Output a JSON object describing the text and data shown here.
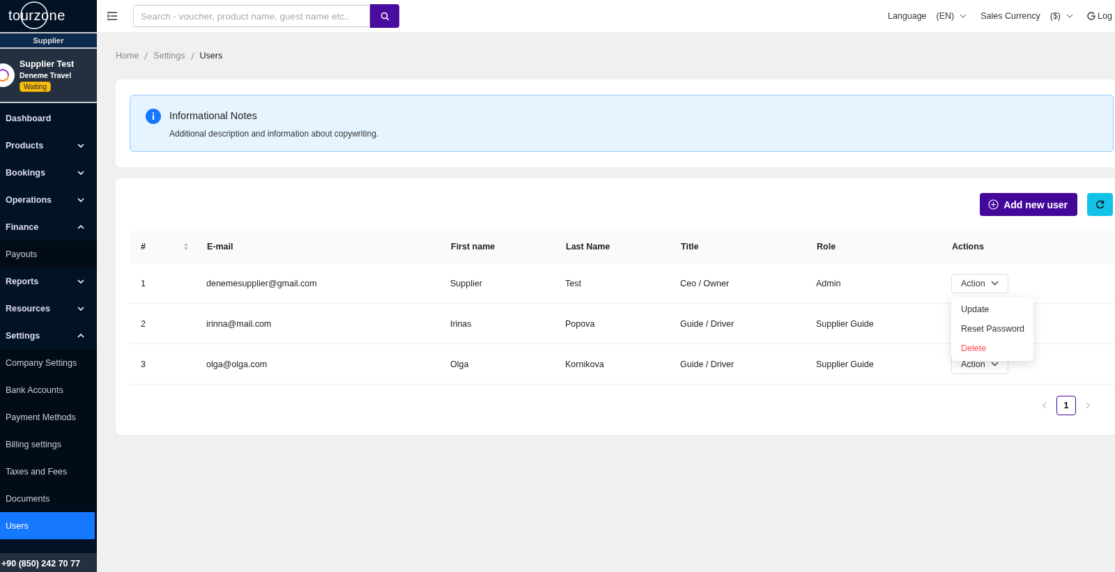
{
  "brand": {
    "logo": "tourzone",
    "role": "Supplier"
  },
  "profile": {
    "name": "Supplier Test",
    "company": "Deneme Travel",
    "status": "Waiting"
  },
  "sidebar": {
    "items": [
      {
        "label": "Dashboard",
        "kind": "item",
        "selected": false
      },
      {
        "label": "Products",
        "kind": "group",
        "expanded": false,
        "selected": false
      },
      {
        "label": "Bookings",
        "kind": "group",
        "expanded": false,
        "selected": false
      },
      {
        "label": "Operations",
        "kind": "group",
        "expanded": false,
        "selected": false
      },
      {
        "label": "Finance",
        "kind": "group",
        "expanded": true,
        "selected": false,
        "children": [
          {
            "label": "Payouts",
            "selected": false
          }
        ]
      },
      {
        "label": "Reports",
        "kind": "group",
        "expanded": false,
        "selected": false
      },
      {
        "label": "Resources",
        "kind": "group",
        "expanded": false,
        "selected": false
      },
      {
        "label": "Settings",
        "kind": "group",
        "expanded": true,
        "selected": false,
        "children": [
          {
            "label": "Company Settings",
            "selected": false
          },
          {
            "label": "Bank Accounts",
            "selected": false
          },
          {
            "label": "Payment Methods",
            "selected": false
          },
          {
            "label": "Billing settings",
            "selected": false
          },
          {
            "label": "Taxes and Fees",
            "selected": false
          },
          {
            "label": "Documents",
            "selected": false
          },
          {
            "label": "Users",
            "selected": true
          }
        ]
      }
    ]
  },
  "phone": "+90 (850) 242 70 77",
  "topbar": {
    "search": {
      "placeholder": "Search - voucher, product name, guest name etc.."
    },
    "language_label": "Language",
    "language": "(EN)",
    "currency_label": "Sales Currency",
    "currency": "($)",
    "logout": "Log"
  },
  "breadcrumb": [
    "Home",
    "Settings",
    "Users"
  ],
  "notice": {
    "title": "Informational Notes",
    "text": "Additional description and information about copywriting."
  },
  "add_button": "Add new user",
  "table": {
    "columns": [
      "#",
      "E-mail",
      "First name",
      "Last Name",
      "Title",
      "Role",
      "Actions"
    ],
    "rows": [
      {
        "cells": [
          "1",
          "denemesupplier@gmail.com",
          "Supplier",
          "Test",
          "Ceo / Owner",
          "Admin"
        ],
        "action": "Action"
      },
      {
        "cells": [
          "2",
          "irinna@mail.com",
          "Irinas",
          "Popova",
          "Guide / Driver",
          "Supplier Guide"
        ]
      },
      {
        "cells": [
          "3",
          "olga@olga.com",
          "Olga",
          "Kornikova",
          "Guide / Driver",
          "Supplier Guide"
        ],
        "action": "Action"
      }
    ]
  },
  "action_menu": [
    {
      "label": "Update",
      "kind": "normal"
    },
    {
      "label": "Reset Password",
      "kind": "normal"
    },
    {
      "label": "Delete",
      "kind": "danger"
    }
  ],
  "pagination": {
    "pages": [
      {
        "label": "1",
        "selected": true
      }
    ]
  }
}
